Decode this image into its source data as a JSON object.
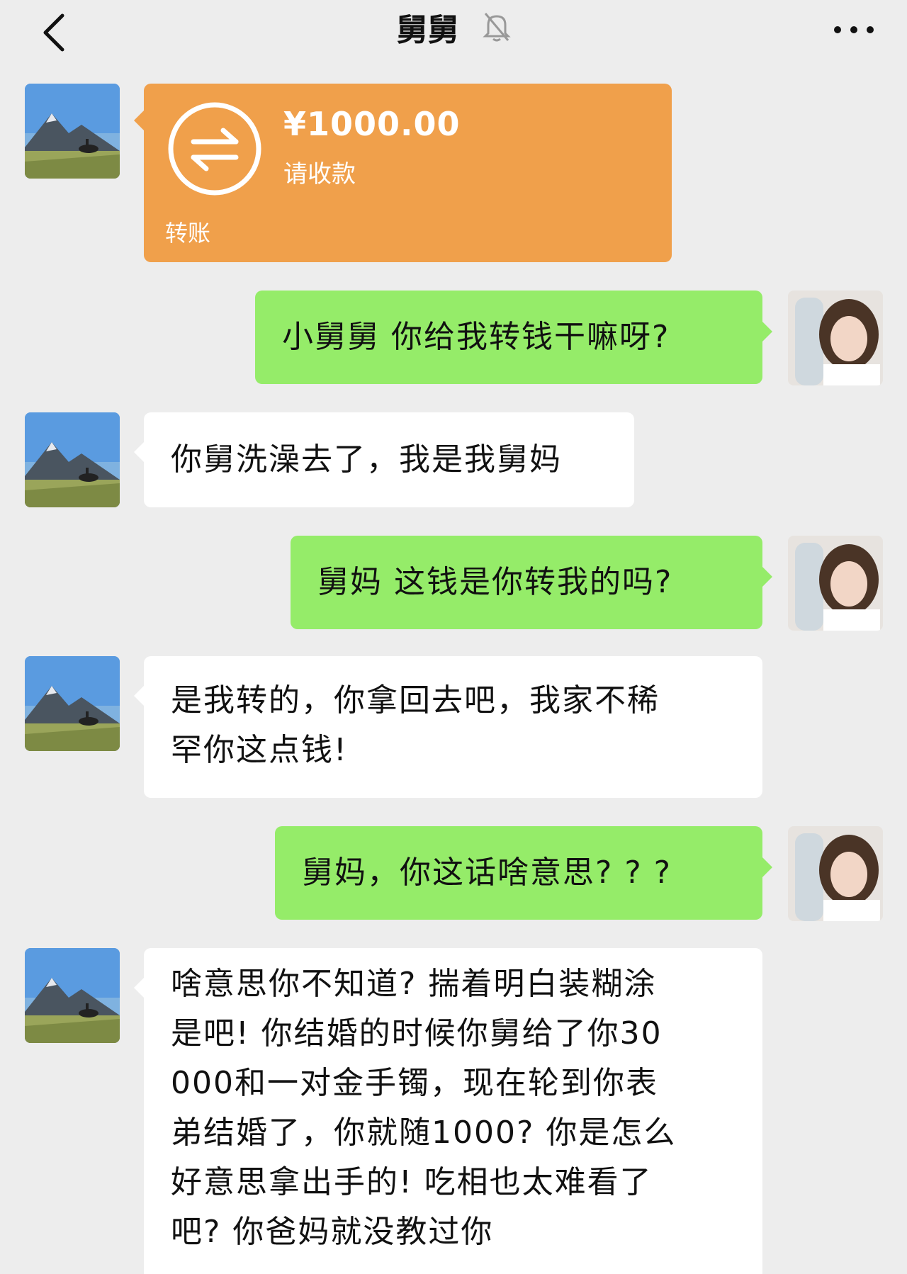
{
  "header": {
    "title": "舅舅",
    "back_icon": "chevron-left-icon",
    "mute_icon": "bell-off-icon",
    "more_icon": "more-dots-icon"
  },
  "messages": [
    {
      "side": "left",
      "type": "transfer",
      "amount": "¥1000.00",
      "status": "请收款",
      "label": "转账"
    },
    {
      "side": "right",
      "type": "text",
      "lines": [
        "小舅舅  你给我转钱干嘛呀?"
      ]
    },
    {
      "side": "left",
      "type": "text",
      "lines": [
        "你舅洗澡去了，我是我舅妈"
      ]
    },
    {
      "side": "right",
      "type": "text",
      "lines": [
        "舅妈  这钱是你转我的吗?"
      ]
    },
    {
      "side": "left",
      "type": "text",
      "lines": [
        "是我转的，你拿回去吧，我家不稀",
        "罕你这点钱!"
      ]
    },
    {
      "side": "right",
      "type": "text",
      "lines": [
        "舅妈，你这话啥意思? ? ?"
      ]
    },
    {
      "side": "left",
      "type": "text",
      "lines": [
        "啥意思你不知道? 揣着明白装糊涂",
        "是吧! 你结婚的时候你舅给了你30",
        "000和一对金手镯，现在轮到你表",
        "弟结婚了，你就随1000? 你是怎么",
        "好意思拿出手的! 吃相也太难看了",
        "吧? 你爸妈就没教过你"
      ]
    }
  ],
  "colors": {
    "background": "#ededed",
    "bubble_self": "#95ec69",
    "bubble_other": "#ffffff",
    "transfer": "#f0a04b"
  }
}
